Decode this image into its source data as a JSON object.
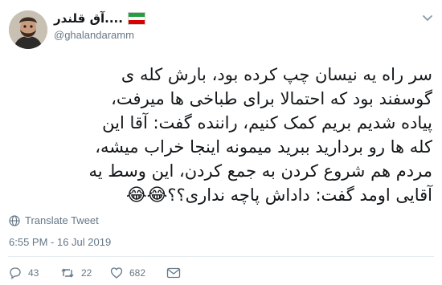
{
  "author": {
    "display_name": "آق قلندر....",
    "handle": "@ghalandaramm",
    "flag_icon": "iran-flag-icon",
    "flag_colors": [
      "#239f40",
      "#ffffff",
      "#da0000"
    ]
  },
  "tweet": {
    "text": "سر راه یه نیسان چپ کرده بود، بارش کله ی\nگوسفند بود که احتمالا برای طباخی ها میرفت،\nپیاده شدیم بریم کمک کنیم، راننده گفت: آقا این\nکله ها رو بردارید ببرید میمونه اینجا خراب میشه،\nمردم هم شروع کردن به جمع کردن، این وسط یه\nآقایی اومد گفت: داداش پاچه نداری؟؟",
    "emojis": "😂😂"
  },
  "translate_label": "Translate Tweet",
  "timestamp": "6:55 PM - 16 Jul 2019",
  "actions": {
    "reply_count": "43",
    "retweet_count": "22",
    "like_count": "682"
  },
  "colors": {
    "text": "#14171a",
    "muted": "#657786",
    "divider": "#e6ecf0"
  }
}
